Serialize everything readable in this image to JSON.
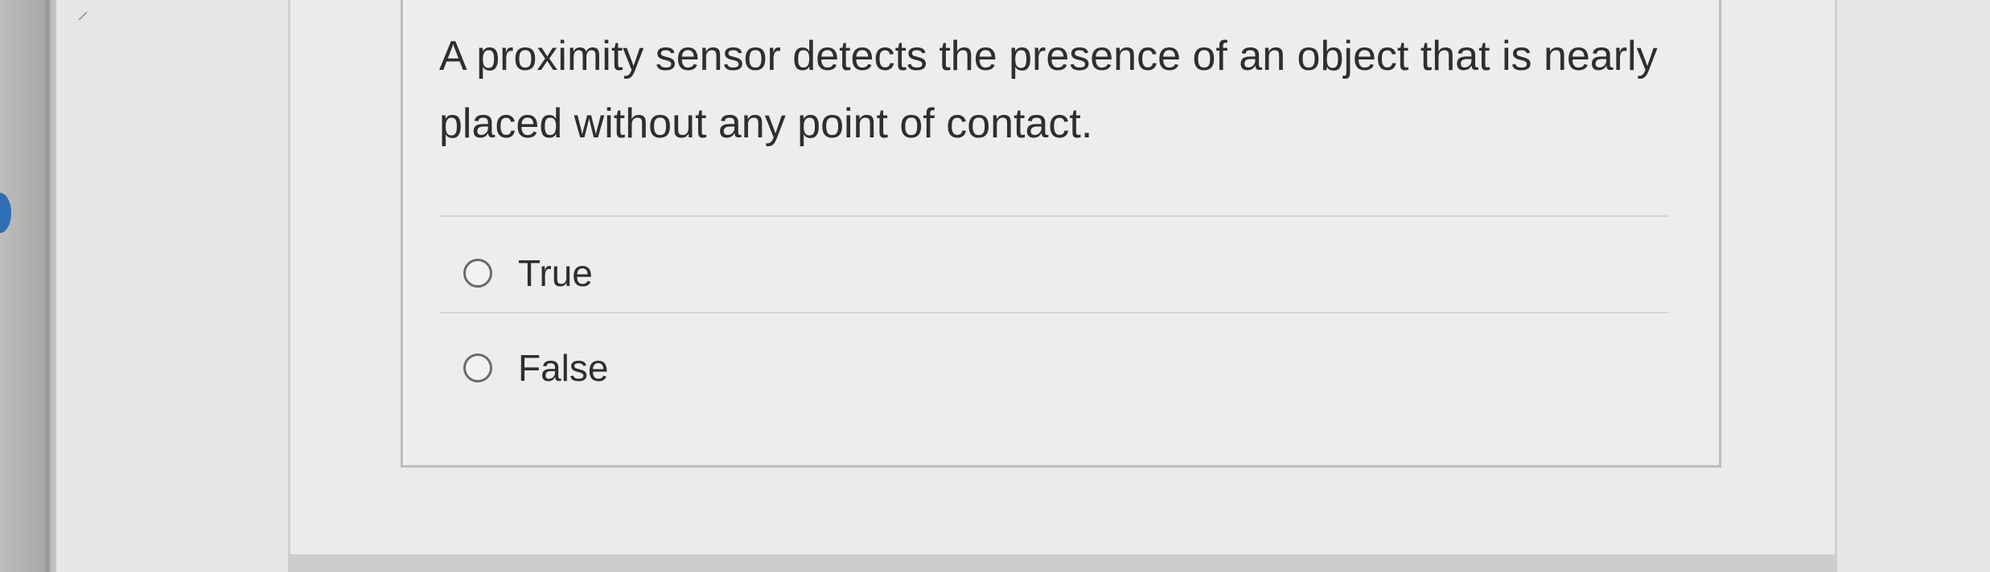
{
  "question": {
    "text": "A proximity sensor detects the presence of an object that is nearly placed without any point of contact."
  },
  "options": [
    {
      "label": "True",
      "selected": false
    },
    {
      "label": "False",
      "selected": false
    }
  ],
  "colors": {
    "background": "#e6e6e4",
    "card_border": "#bdbdbb",
    "text": "#2e2e2e",
    "radio_border": "#6a6a6a",
    "left_indicator": "#2f6fb5"
  },
  "icons": {
    "radio": "radio-unselected-icon"
  }
}
